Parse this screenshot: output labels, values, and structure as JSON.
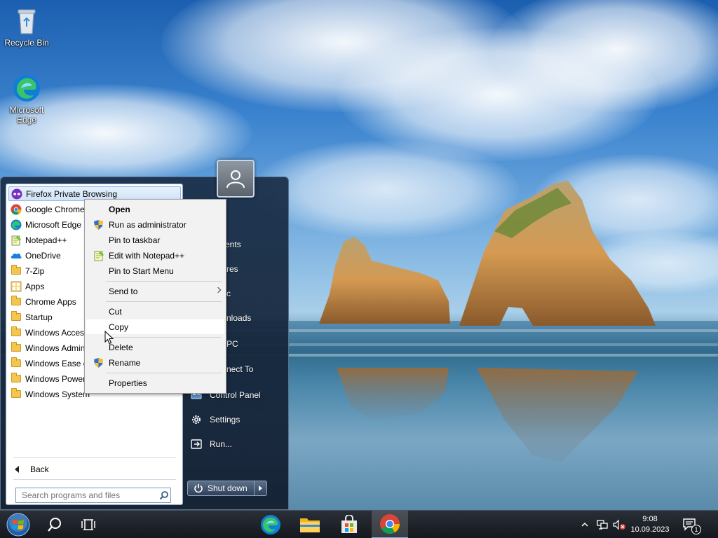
{
  "desktop": {
    "icons": [
      {
        "label": "Recycle Bin"
      },
      {
        "label": "Microsoft Edge"
      }
    ]
  },
  "start_menu": {
    "programs": [
      {
        "label": "Firefox Private Browsing",
        "icon": "firefox-private-icon"
      },
      {
        "label": "Google Chrome",
        "icon": "chrome-icon"
      },
      {
        "label": "Microsoft Edge",
        "icon": "edge-icon"
      },
      {
        "label": "Notepad++",
        "icon": "notepad-plus-plus-icon"
      },
      {
        "label": "OneDrive",
        "icon": "onedrive-icon"
      },
      {
        "label": "7-Zip",
        "icon": "folder-icon"
      },
      {
        "label": "Apps",
        "icon": "apps-icon"
      },
      {
        "label": "Chrome Apps",
        "icon": "folder-icon"
      },
      {
        "label": "Startup",
        "icon": "folder-icon"
      },
      {
        "label": "Windows Access",
        "icon": "folder-icon"
      },
      {
        "label": "Windows Admin",
        "icon": "folder-icon"
      },
      {
        "label": "Windows Ease of",
        "icon": "folder-icon"
      },
      {
        "label": "Windows PowerS",
        "icon": "folder-icon"
      },
      {
        "label": "Windows System",
        "icon": "folder-icon"
      }
    ],
    "back_label": "Back",
    "search_placeholder": "Search programs and files",
    "right_items": [
      {
        "label": "ments",
        "icon": ""
      },
      {
        "label": "res",
        "icon": ""
      },
      {
        "label": "c",
        "icon": ""
      },
      {
        "label": "nloads",
        "icon": ""
      },
      {
        "label": "PC",
        "icon": ""
      },
      {
        "label": "nect To",
        "icon": ""
      },
      {
        "label": "Control Panel",
        "icon": "control-panel-icon"
      },
      {
        "label": "Settings",
        "icon": "gear-icon"
      },
      {
        "label": "Run...",
        "icon": "run-icon"
      }
    ],
    "shutdown_label": "Shut down"
  },
  "context_menu": {
    "items": [
      {
        "label": "Open",
        "bold": true,
        "icon": ""
      },
      {
        "label": "Run as administrator",
        "icon": "uac-shield-icon"
      },
      {
        "label": "Pin to taskbar",
        "icon": ""
      },
      {
        "label": "Edit with Notepad++",
        "icon": "notepad-plus-plus-icon"
      },
      {
        "label": "Pin to Start Menu",
        "icon": ""
      },
      {
        "label": "Send to",
        "icon": "",
        "submenu": true
      },
      {
        "label": "Cut",
        "icon": ""
      },
      {
        "label": "Copy",
        "icon": "",
        "hover": true
      },
      {
        "label": "Delete",
        "icon": ""
      },
      {
        "label": "Rename",
        "icon": "uac-shield-icon"
      },
      {
        "label": "Properties",
        "icon": ""
      }
    ]
  },
  "taskbar": {
    "time": "9:08",
    "date": "10.09.2023",
    "notification_count": "1"
  },
  "colors": {
    "taskbar_active_underline": "#7fb5ee",
    "menu_highlight": "#cfe3f8"
  }
}
